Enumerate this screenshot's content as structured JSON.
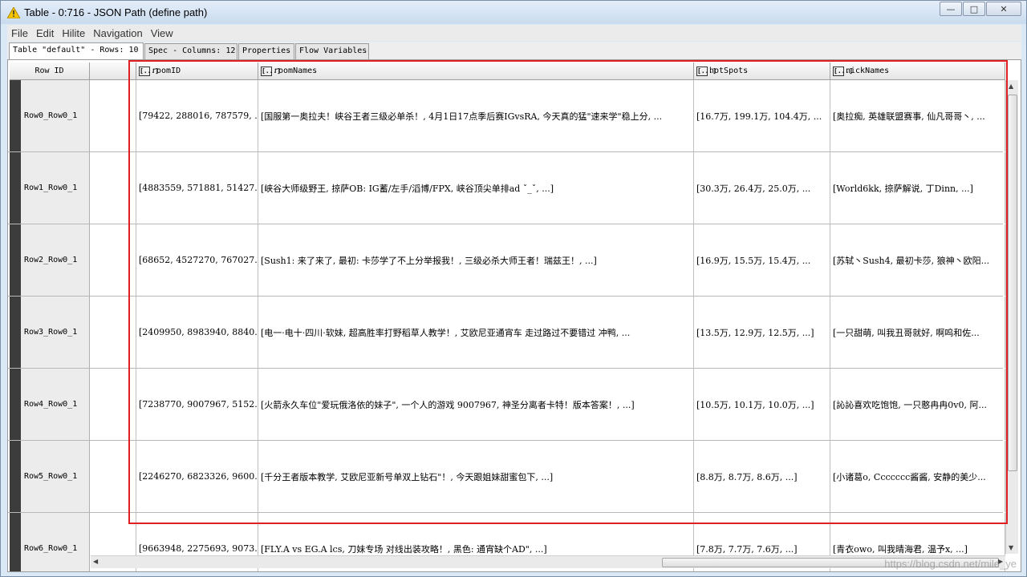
{
  "window": {
    "title": "Table - 0:716 - JSON Path (define path)",
    "controls": {
      "minimize": "—",
      "maximize": "□",
      "close": "✕"
    }
  },
  "menu": [
    "File",
    "Edit",
    "Hilite",
    "Navigation",
    "View"
  ],
  "tabs": [
    "Table \"default\" - Rows: 10",
    "Spec - Columns: 12",
    "Properties",
    "Flow Variables"
  ],
  "columns": {
    "row_id": "Row ID",
    "type_icon": "[...]",
    "headers": [
      "roomID",
      "roomNames",
      "hotSpots",
      "nickNames"
    ]
  },
  "rows": [
    {
      "id": "Row0_Row0_1",
      "roomID": "[79422, 288016, 787579, ...",
      "roomNames": "[国服第一奥拉夫！峡谷王者三级必单杀！, 4月1日17点季后赛IGvsRA, 今天真的猛\"速来学\"稳上分, ...",
      "hotSpots": "[16.7万, 199.1万, 104.4万, ...",
      "nickNames": "[奥拉痴, 英雄联盟赛事, 仙凡哥哥丶, ..."
    },
    {
      "id": "Row1_Row0_1",
      "roomID": "[4883559, 571881, 51427...",
      "roomNames": "[峡谷大师级野王, 掠萨OB: IG蓄/左手/滔博/FPX, 峡谷顶尖单排ad ˇ_ˇ, ...]",
      "hotSpots": "[30.3万, 26.4万, 25.0万, ...",
      "nickNames": "[World6kk, 掠萨解说, 丁Dinn, ...]"
    },
    {
      "id": "Row2_Row0_1",
      "roomID": "[68652, 4527270, 767027...",
      "roomNames": "[Sush1: 来了来了, 最初: 卡莎学了不上分举报我！, 三级必杀大师王者！瑞兹王！, ...]",
      "hotSpots": "[16.9万, 15.5万, 15.4万, ...",
      "nickNames": "[苏轼丶Sush4, 最初卡莎, 狼神丶欧阳..."
    },
    {
      "id": "Row3_Row0_1",
      "roomID": "[2409950, 8983940, 8840...",
      "roomNames": "[电一·电十·四川·软妹, 超高胜率打野稻草人教学！, 艾欧尼亚通宵车 走过路过不要错过 冲鸭, ...",
      "hotSpots": "[13.5万, 12.9万, 12.5万, ...]",
      "nickNames": "[一只甜萌, 叫我丑哥就好, 啊呜和佐..."
    },
    {
      "id": "Row4_Row0_1",
      "roomID": "[7238770, 9007967, 5152...",
      "roomNames": "[火箭永久车位\"爱玩俄洛依的妹子\", 一个人的游戏 9007967, 神圣分离者卡特！版本答案！, ...]",
      "hotSpots": "[10.5万, 10.1万, 10.0万, ...]",
      "nickNames": "[訫訫喜欢吃饱饱, 一只憨冉冉0v0, 阿..."
    },
    {
      "id": "Row5_Row0_1",
      "roomID": "[2246270, 6823326, 9600...",
      "roomNames": "[千分王者版本教学, 艾欧尼亚新号单双上钻石\"！, 今天跟姐妹甜蜜包下, ...]",
      "hotSpots": "[8.8万, 8.7万, 8.6万, ...]",
      "nickNames": "[小诸葛o, Ccccccc酱酱, 安静的美少..."
    },
    {
      "id": "Row6_Row0_1",
      "roomID": "[9663948, 2275693, 9073...",
      "roomNames": "[FLY.A vs EG.A  lcs, 刀妹专场 对线出装攻略！, 黑色: 通宵缺个AD\", ...]",
      "hotSpots": "[7.8万, 7.7万, 7.6万, ...]",
      "nickNames": "[青衣owo, 叫我晴海君, 温予x, ...]"
    }
  ],
  "watermark": "https://blog.csdn.net/mile_ye",
  "colors": {
    "highlight_box": "#e02020",
    "row_marker": "#3c3c3c"
  }
}
